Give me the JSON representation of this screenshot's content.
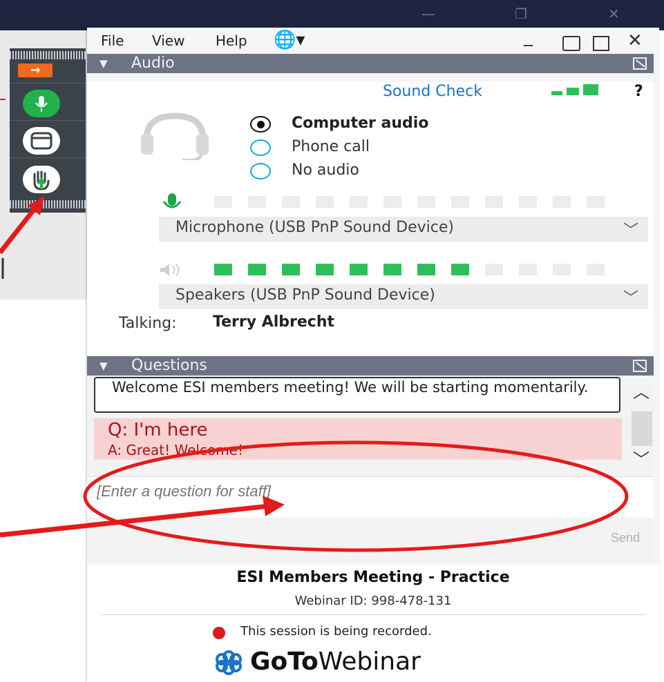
{
  "menu": {
    "file": "File",
    "view": "View",
    "help": "Help"
  },
  "audio": {
    "header": "Audio",
    "sound_check": "Sound Check",
    "help_mark": "?",
    "options": [
      {
        "label": "Computer audio",
        "selected": true
      },
      {
        "label": "Phone call",
        "selected": false
      },
      {
        "label": "No audio",
        "selected": false
      }
    ],
    "microphone": "Microphone (USB PnP Sound Device)",
    "speakers": "Speakers (USB PnP Sound Device)",
    "speaker_level_segments": 8,
    "meter_total_segments": 12,
    "talking_label": "Talking:",
    "talking_name": "Terry Albrecht"
  },
  "questions": {
    "header": "Questions",
    "welcome": "Welcome ESI members meeting!  We will be starting momentarily.",
    "question": "Q: I'm here",
    "answer": "A: Great! Welcome!",
    "input_placeholder": "[Enter a question for staff]",
    "send": "Send"
  },
  "footer": {
    "meeting_title": "ESI Members Meeting - Practice",
    "webinar_id": "Webinar ID: 998-478-131",
    "recording_notice": "This session is being recorded.",
    "brand_goto": "GoTo",
    "brand_webinar": "Webinar"
  },
  "colors": {
    "accent_blue": "#1a73c9",
    "level_green": "#2fbf5a",
    "annotation_red": "#e41b1b",
    "header_gray": "#6d7384"
  }
}
